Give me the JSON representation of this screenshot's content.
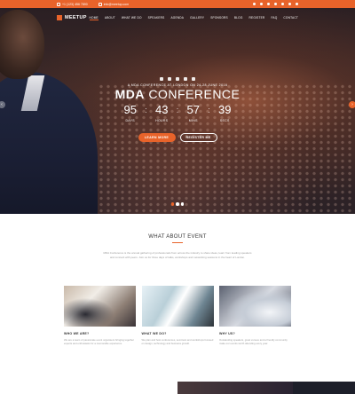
{
  "topbar": {
    "phone": "+1 (123) 456 7890",
    "email": "info@meetup.com"
  },
  "nav": {
    "logo": "MEETUP",
    "items": [
      "HOME",
      "ABOUT",
      "WHAT WE DO",
      "SPEAKERS",
      "AGENDA",
      "GALLERY",
      "SPONSORS",
      "BLOG",
      "REGISTER",
      "FAQ",
      "CONTACT"
    ]
  },
  "hero": {
    "subtitle": "A MDA CONFERENCE AT LONDON ON 24-28 JUNE 2016",
    "title_bold": "MDA",
    "title_rest": "CONFERENCE",
    "countdown": [
      {
        "value": "95",
        "label": "DAYS"
      },
      {
        "value": "43",
        "label": "HOURS"
      },
      {
        "value": "57",
        "label": "MINS"
      },
      {
        "value": "39",
        "label": "SECS"
      }
    ],
    "btn_primary": "LEARN MORE",
    "btn_secondary": "REGISTER ME",
    "social_icons": [
      "facebook-icon",
      "twitter-icon",
      "youtube-icon",
      "google-plus-icon",
      "instagram-icon"
    ]
  },
  "about": {
    "title": "WHAT ABOUT EVENT",
    "intro": "MDA Conference is the annual gathering of professionals from across the industry to share ideas, learn from leading speakers and connect with peers. Join us for three days of talks, workshops and networking sessions in the heart of London."
  },
  "cards": [
    {
      "heading": "WHO WE ARE?",
      "text": "We are a team of passionate event organisers bringing together experts and enthusiasts for a memorable experience."
    },
    {
      "heading": "WHAT WE DO?",
      "text": "We plan and host conferences, seminars and workshops focused on design, technology and business growth."
    },
    {
      "heading": "WHY US?",
      "text": "Outstanding speakers, great venues and a friendly community make our events worth attending every year."
    }
  ],
  "colors": {
    "accent": "#e8632a"
  }
}
